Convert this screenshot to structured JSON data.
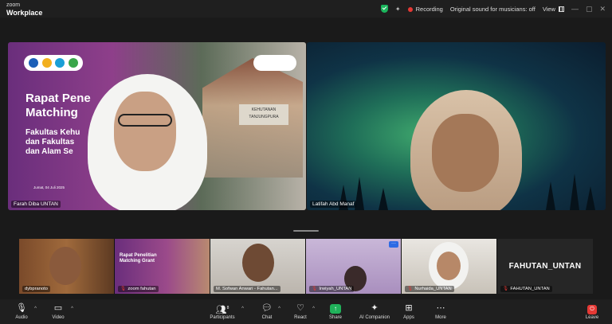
{
  "app": {
    "logo_line1": "zoom",
    "logo_line2": "Workplace"
  },
  "titlebar": {
    "recording_label": "Recording",
    "original_sound": "Original sound for musicians: off",
    "view_label": "View"
  },
  "main": {
    "tiles": [
      {
        "name": "Farah Diba UNTAN",
        "slide_title": "Rapat Pene",
        "slide_title_2": "Matching",
        "slide_sub_1": "Fakultas Kehu",
        "slide_sub_2": "dan Fakultas",
        "slide_sub_3": "dan Alam Se",
        "slide_date": "Jumat, 04 Juli 2025",
        "sign_text": "KEHUTANAN TANJUNGPURA"
      },
      {
        "name": "Latifah Abd Manaf"
      }
    ]
  },
  "gallery": [
    {
      "name": "dybpranoto",
      "muted": false
    },
    {
      "name": "zoom fahutan",
      "muted": true,
      "slide_title": "Rapat Penelitian",
      "slide_title_2": "Matching Grant"
    },
    {
      "name": "M. Sofwan Anwari - Fahutan...",
      "muted": false
    },
    {
      "name": "Irwiyah_UNTAN",
      "muted": true
    },
    {
      "name": "Nurhaida_UNTAN",
      "muted": true
    },
    {
      "name": "FAHUTAN_UNTAN",
      "muted": true,
      "big_name": "FAHUTAN_UNTAN"
    }
  ],
  "toolbar": {
    "audio": "Audio",
    "video": "Video",
    "participants": "Participants",
    "participants_count": "8",
    "chat": "Chat",
    "react": "React",
    "share": "Share",
    "ai_companion": "AI Companion",
    "apps": "Apps",
    "more": "More",
    "leave": "Leave"
  },
  "icons": {
    "audio": "microphone-icon",
    "video": "camera-icon",
    "participants": "people-icon",
    "chat": "chat-bubble-icon",
    "react": "heart-icon",
    "share": "share-screen-icon",
    "ai_companion": "sparkle-icon",
    "apps": "apps-icon",
    "more": "more-icon",
    "leave": "leave-icon"
  },
  "colors": {
    "accent": "#2d6be4",
    "recording": "#e53935",
    "share": "#20b15a",
    "secure": "#1bb55c"
  }
}
